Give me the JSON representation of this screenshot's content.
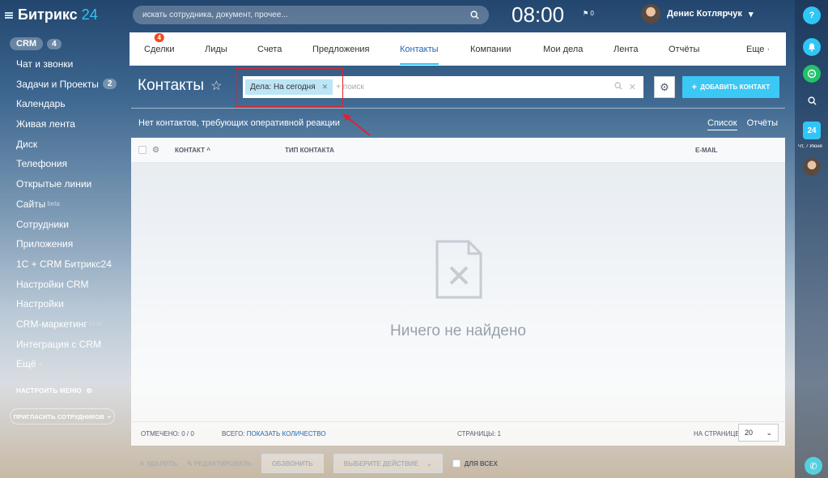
{
  "logo": {
    "name": "Битрикс",
    "suffix": "24"
  },
  "sidebar": {
    "crm": {
      "label": "CRM",
      "count": "4"
    },
    "items": [
      {
        "label": "Чат и звонки",
        "count": "",
        "sup": ""
      },
      {
        "label": "Задачи и Проекты",
        "count": "2",
        "sup": ""
      },
      {
        "label": "Календарь",
        "count": "",
        "sup": ""
      },
      {
        "label": "Живая лента",
        "count": "",
        "sup": ""
      },
      {
        "label": "Диск",
        "count": "",
        "sup": ""
      },
      {
        "label": "Телефония",
        "count": "",
        "sup": ""
      },
      {
        "label": "Открытые линии",
        "count": "",
        "sup": ""
      },
      {
        "label": "Сайты",
        "count": "",
        "sup": "beta"
      },
      {
        "label": "Сотрудники",
        "count": "",
        "sup": ""
      },
      {
        "label": "Приложения",
        "count": "",
        "sup": ""
      },
      {
        "label": "1С + CRM Битрикс24",
        "count": "",
        "sup": ""
      },
      {
        "label": "Настройки CRM",
        "count": "",
        "sup": ""
      },
      {
        "label": "Настройки",
        "count": "",
        "sup": ""
      },
      {
        "label": "CRM-маркетинг",
        "count": "",
        "sup": "beta"
      },
      {
        "label": "Интеграция с CRM",
        "count": "",
        "sup": ""
      },
      {
        "label": "Ещё ·",
        "count": "",
        "sup": ""
      }
    ],
    "setup_menu": "НАСТРОИТЬ МЕНЮ",
    "invite": "ПРИГЛАСИТЬ СОТРУДНИКОВ",
    "invite_plus": "+"
  },
  "topbar": {
    "search_placeholder": "искать сотрудника, документ, прочее...",
    "time": "08:00",
    "flag_count": "0",
    "user_name": "Денис Котлярчук"
  },
  "rightbar": {
    "help": "?",
    "calendar_day": "24",
    "calendar_date": "Чт, 7 Июня"
  },
  "tabs": [
    {
      "label": "Сделки",
      "badge": "4"
    },
    {
      "label": "Лиды",
      "badge": ""
    },
    {
      "label": "Счета",
      "badge": ""
    },
    {
      "label": "Предложения",
      "badge": ""
    },
    {
      "label": "Контакты",
      "badge": ""
    },
    {
      "label": "Компании",
      "badge": ""
    },
    {
      "label": "Мои дела",
      "badge": ""
    },
    {
      "label": "Лента",
      "badge": ""
    },
    {
      "label": "Отчёты",
      "badge": ""
    },
    {
      "label": "Еще ·",
      "badge": ""
    }
  ],
  "page": {
    "title": "Контакты",
    "filter_tag": "Дела: На сегодня",
    "filter_placeholder": "+ поиск",
    "add_button": "ДОБАВИТЬ КОНТАКТ",
    "notice": "Нет контактов, требующих оперативной реакции",
    "view_list": "Список",
    "view_reports": "Отчёты"
  },
  "grid": {
    "col_contact": "КОНТАКТ",
    "col_type": "ТИП КОНТАКТА",
    "col_email": "E-MAIL",
    "empty": "Ничего не найдено",
    "marked_label": "ОТМЕЧЕНО:",
    "marked_value": "0 / 0",
    "total_label": "ВСЕГО:",
    "total_link": "ПОКАЗАТЬ КОЛИЧЕСТВО",
    "pages_label": "СТРАНИЦЫ:",
    "pages_value": "1",
    "per_page_label": "НА СТРАНИЦЕ:",
    "per_page_value": "20"
  },
  "actions": {
    "delete": "УДАЛИТЬ",
    "edit": "РЕДАКТИРОВАТЬ",
    "call": "ОБЗВОНИТЬ",
    "choose": "ВЫБЕРИТЕ ДЕЙСТВИЕ",
    "for_all": "ДЛЯ ВСЕХ"
  }
}
